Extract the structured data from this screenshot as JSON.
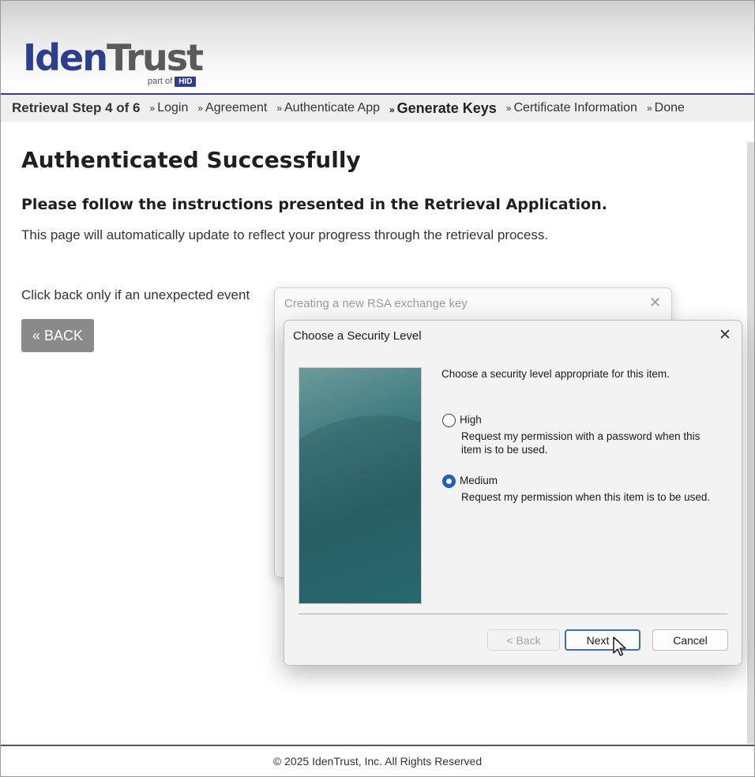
{
  "header": {
    "logo_iden": "Iden",
    "logo_trust": "Trust",
    "logo_partof": "part of",
    "logo_hid": "HID"
  },
  "steps": {
    "counter": "Retrieval Step 4 of 6",
    "separator": "»",
    "items": [
      {
        "label": "Login"
      },
      {
        "label": "Agreement"
      },
      {
        "label": "Authenticate App"
      },
      {
        "label": "Generate Keys",
        "current": true
      },
      {
        "label": "Certificate Information"
      },
      {
        "label": "Done"
      }
    ]
  },
  "main": {
    "title": "Authenticated Successfully",
    "subtitle": "Please follow the instructions presented in the Retrieval Application.",
    "description": "This page will automatically update to reflect your progress through the retrieval process.",
    "back_note": "Click back only if an unexpected event",
    "back_label": "« BACK"
  },
  "background_dialog": {
    "title": "Creating a new RSA exchange key",
    "close": "✕"
  },
  "dialog": {
    "title": "Choose a Security Level",
    "close": "✕",
    "prompt": "Choose a security level appropriate for this item.",
    "options": [
      {
        "label": "High",
        "description": "Request my permission with a password when this item is to be used.",
        "selected": false
      },
      {
        "label": "Medium",
        "description": "Request my permission when this item is to be used.",
        "selected": true
      }
    ],
    "back_label": "< Back",
    "next_label": "Next >",
    "cancel_label": "Cancel"
  },
  "footer": {
    "copyright": "© 2025 IdenTrust, Inc. All Rights Reserved"
  },
  "colors": {
    "brand_blue": "#2d3e8e",
    "radio_blue": "#1f5fb8"
  }
}
